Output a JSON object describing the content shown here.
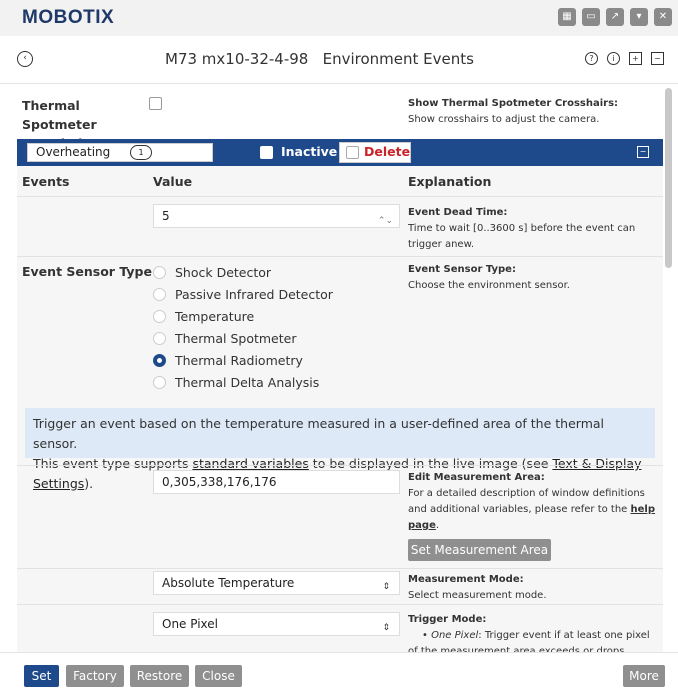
{
  "brand": {
    "logo": "MOBOTIX"
  },
  "header": {
    "title": "M73 mx10-32-4-98   Environment Events"
  },
  "crosshairs": {
    "label": "Thermal Spotmeter Crosshairs",
    "explanation_title": "Show Thermal Spotmeter Crosshairs:",
    "explanation_text": "Show crosshairs to adjust the camera."
  },
  "profile": {
    "name": "Overheating",
    "badge": "1",
    "inactive_label": "Inactive",
    "delete_label": "Delete"
  },
  "table": {
    "headers": {
      "events": "Events",
      "value": "Value",
      "explanation": "Explanation"
    },
    "dead_time": {
      "value": "5",
      "exp_title": "Event Dead Time:",
      "exp_text": "Time to wait [0..3600 s] before the event can trigger anew."
    },
    "sensor_type": {
      "label": "Event Sensor Type",
      "options": [
        "Shock Detector",
        "Passive Infrared Detector",
        "Temperature",
        "Thermal Spotmeter",
        "Thermal Radiometry",
        "Thermal Delta Analysis"
      ],
      "selected": "Thermal Radiometry",
      "exp_title": "Event Sensor Type:",
      "exp_text": "Choose the environment sensor."
    },
    "info": {
      "line1": "Trigger an event based on the temperature measured in a user-defined area of the thermal sensor.",
      "line2_a": "This event type supports ",
      "line2_link1": "standard variables",
      "line2_b": " to be displayed in the live image (see ",
      "line2_link2": "Text & Display Settings",
      "line2_c": ")."
    },
    "measurement_area": {
      "value": "0,305,338,176,176",
      "exp_title": "Edit Measurement Area:",
      "exp_text": "For a detailed description of window definitions and additional variables, please refer to the ",
      "exp_link": "help page",
      "exp_end": ".",
      "button": "Set Measurement Area"
    },
    "measurement_mode": {
      "value": "Absolute Temperature",
      "exp_title": "Measurement Mode:",
      "exp_text": "Select measurement mode."
    },
    "trigger_mode": {
      "value": "One Pixel",
      "exp_title": "Trigger Mode:",
      "bullet_term": "One Pixel",
      "bullet_text": ": Trigger event if at least one pixel of the measurement area exceeds or drops"
    }
  },
  "footer": {
    "set": "Set",
    "factory": "Factory",
    "restore": "Restore",
    "close": "Close",
    "more": "More"
  },
  "colors": {
    "brand_blue": "#1e4a8c",
    "delete_red": "#c8242a",
    "info_bg": "#dde9f7"
  }
}
